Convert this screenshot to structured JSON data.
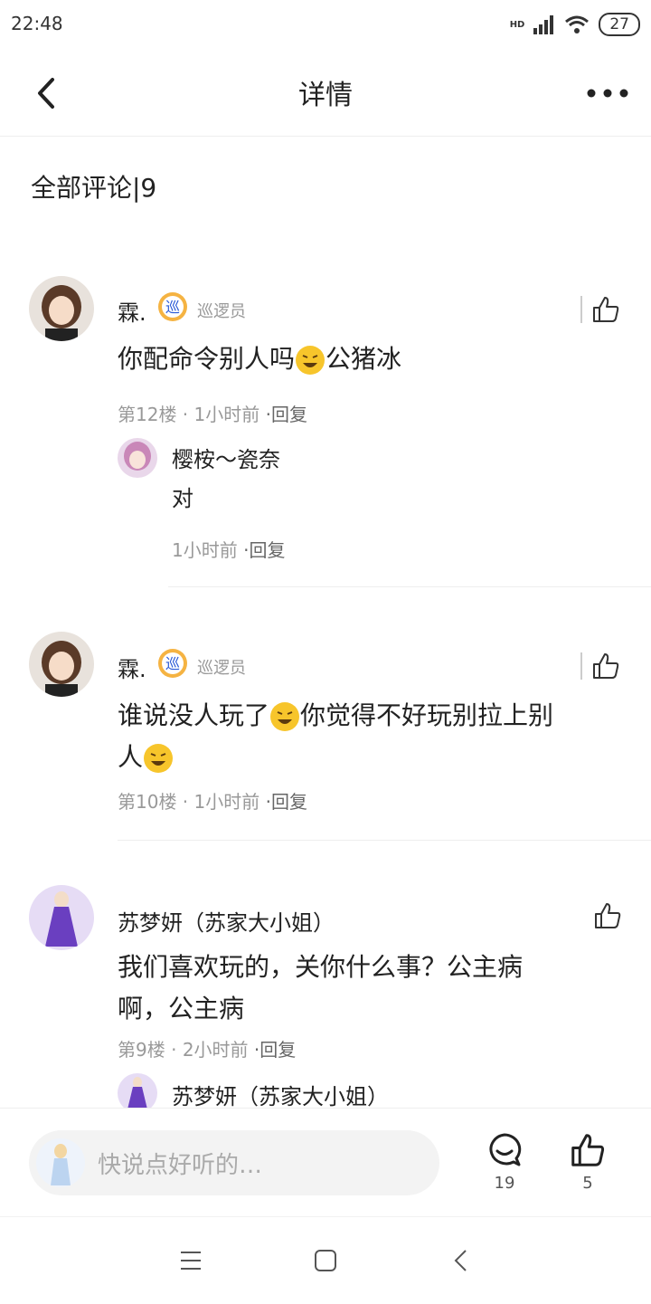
{
  "status_bar": {
    "time": "22:48",
    "network": "HD",
    "battery": "27"
  },
  "header": {
    "title": "详情"
  },
  "section_title": "全部评论|9",
  "comments": [
    {
      "username": "霖.",
      "badge": "巡",
      "role": "巡逻员",
      "text": "你配命令别人吗",
      "text_after_emoji": "公猪冰",
      "floor": "第12楼",
      "time": "1小时前",
      "reply_label": "·回复",
      "reply": {
        "username": "樱桉～瓷奈",
        "text": "对",
        "time": "1小时前",
        "reply_label": "·回复"
      }
    },
    {
      "username": "霖.",
      "badge": "巡",
      "role": "巡逻员",
      "text_part1": "谁说没人玩了",
      "text_part2": "你觉得不好玩别拉上别",
      "text_part3": "人",
      "floor": "第10楼",
      "time": "1小时前",
      "reply_label": "·回复"
    },
    {
      "username": "苏梦妍（苏家大小姐）",
      "text_line1": "我们喜欢玩的，关你什么事？公主病",
      "text_line2": "啊，公主病",
      "floor": "第9楼",
      "time": "2小时前",
      "reply_label": "·回复",
      "reply": {
        "username": "苏梦妍（苏家大小姐）"
      }
    }
  ],
  "bottom_bar": {
    "placeholder": "快说点好听的…",
    "comment_count": "19",
    "like_count": "5"
  },
  "icons": [
    "back-icon",
    "more-icon",
    "like-icon",
    "comment-icon",
    "laughing-emoji-icon",
    "menu-icon",
    "home-icon",
    "nav-back-icon"
  ]
}
